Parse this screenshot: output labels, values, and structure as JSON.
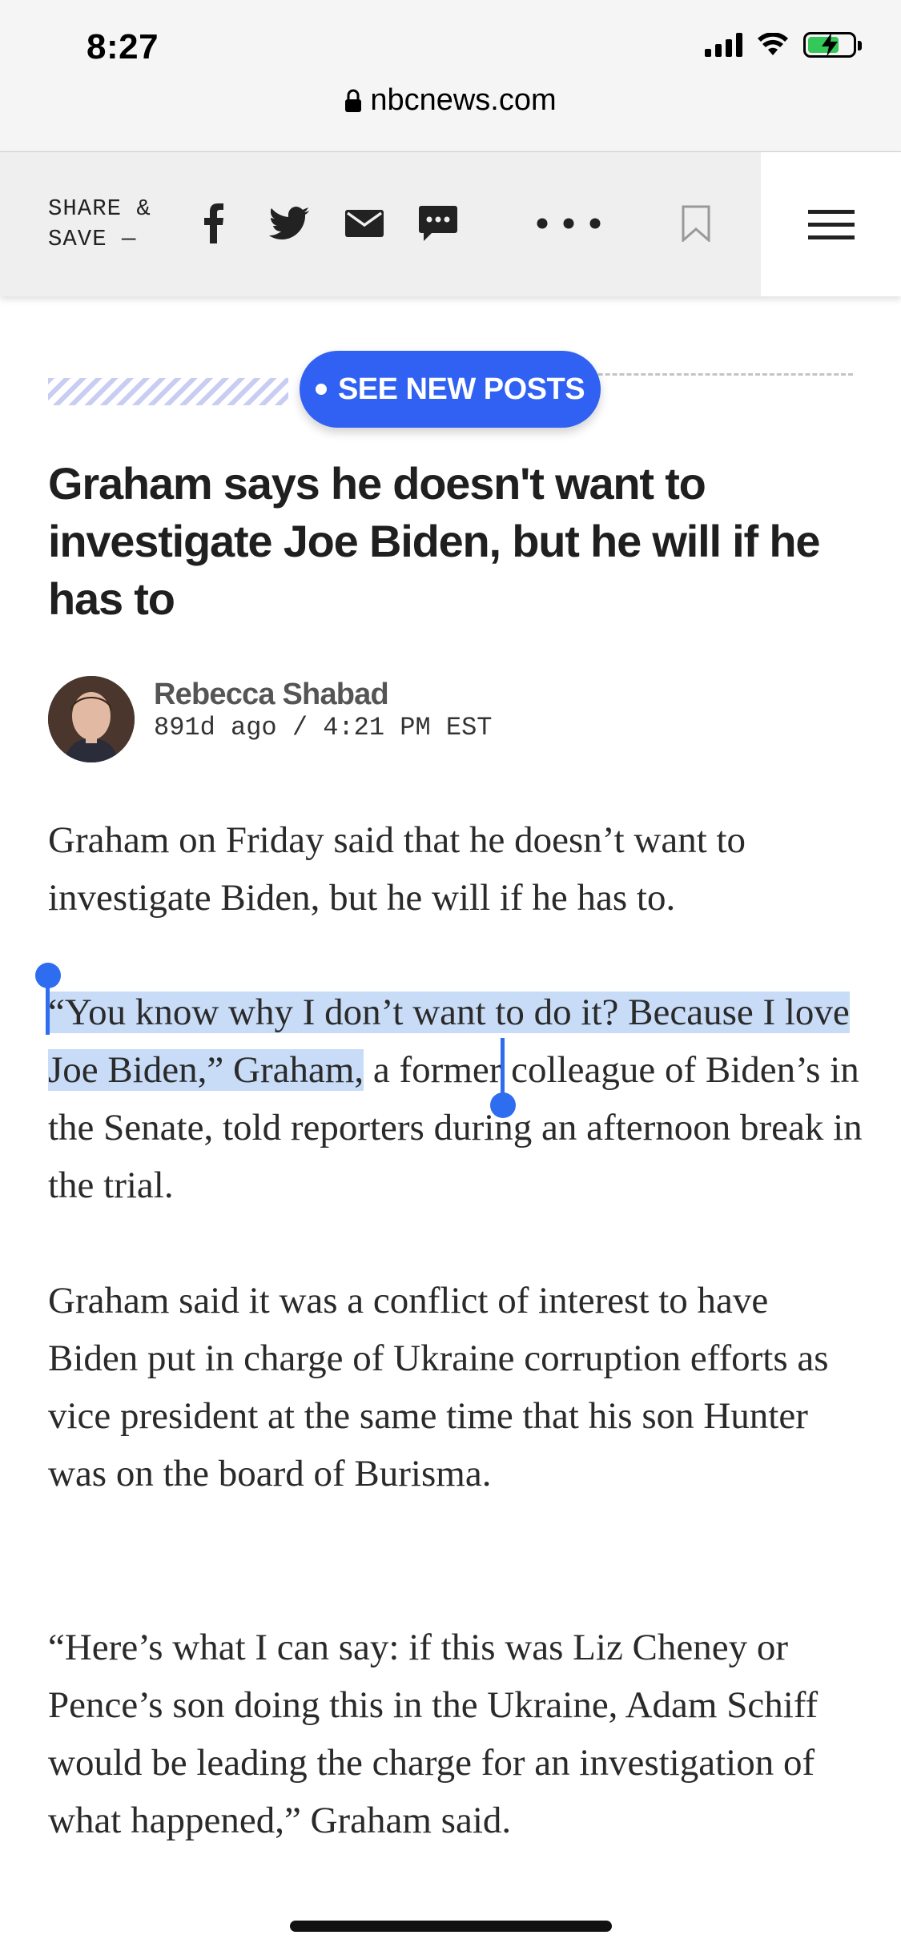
{
  "status": {
    "time": "8:27",
    "url": "nbcnews.com"
  },
  "share": {
    "label": "SHARE &\nSAVE —",
    "icons": [
      "facebook-icon",
      "twitter-icon",
      "email-icon",
      "sms-icon",
      "more-icon",
      "bookmark-icon",
      "menu-icon"
    ]
  },
  "new_posts": {
    "label": "SEE NEW POSTS"
  },
  "article": {
    "headline": "Graham says he doesn't want to investigate Joe Biden, but he will if he has to",
    "author": "Rebecca Shabad",
    "dateline": "891d ago / 4:21 PM EST",
    "p1": "Graham on Friday said that he doesn’t want to investigate Biden, but he will if he has to.",
    "p2_selected": "“You know why I don’t want to do it? Because I love Joe Biden,” Graham,",
    "p2_rest": " a former colleague of Biden’s in the Senate, told reporters during an afternoon break in the trial.",
    "p3": "Graham said it was a conflict of interest to have Biden put in charge of Ukraine corruption efforts as vice president at the same time that his son Hunter was on the board of Burisma.",
    "p4": "“Here’s what I can say: if this was Liz Cheney or Pence’s son doing this in the Ukraine, Adam Schiff would be leading the charge for an investigation of what happened,” Graham said."
  },
  "colors": {
    "accent": "#3061f2",
    "selection": "#c8dcf7",
    "selection_handle": "#2e6cf0"
  }
}
